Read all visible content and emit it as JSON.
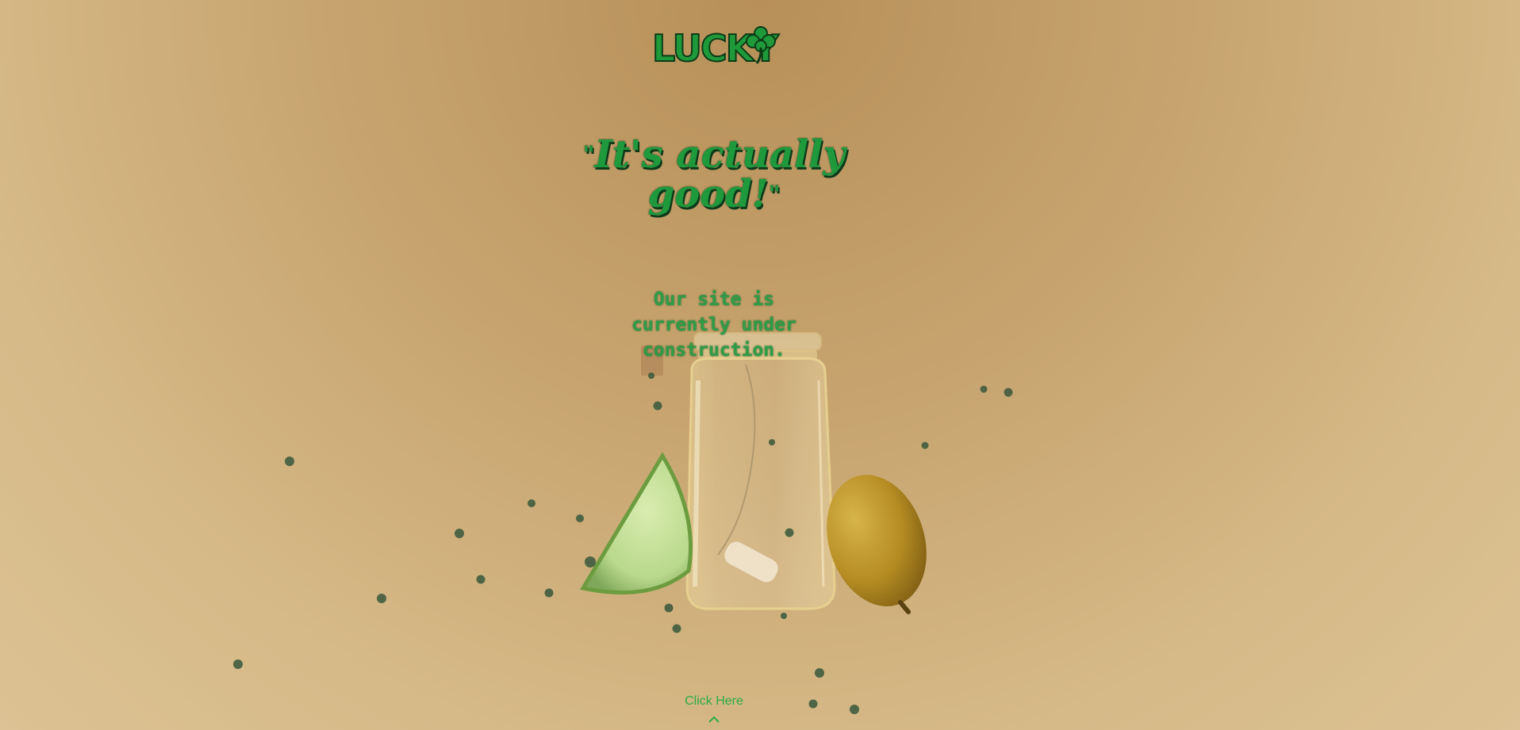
{
  "brand": {
    "logo_text": "LUCKY"
  },
  "hero": {
    "quote_open": "\"",
    "headline": "It's actually good!",
    "quote_close": "\"",
    "subtitle": "Our site is currently under construction."
  },
  "cta": {
    "label": "Click Here",
    "icon": "chevron-up-icon"
  },
  "colors": {
    "accent": "#1e9a3c",
    "bg_top": "#b78f58",
    "bg_bottom": "#dcc294"
  }
}
